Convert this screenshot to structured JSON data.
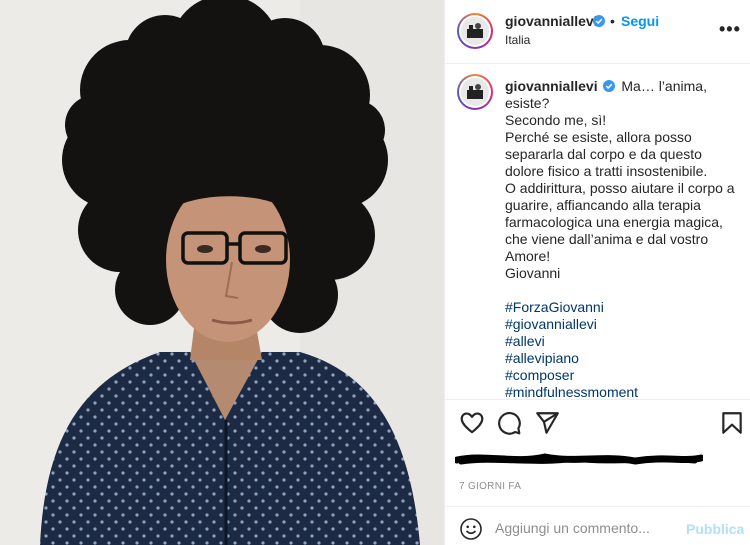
{
  "post": {
    "username": "giovanniallevi",
    "dot": "•",
    "follow_label": "Segui",
    "location": "Italia",
    "more_icon": "more-horizontal-icon",
    "verified_color": "#3897f0"
  },
  "caption": {
    "username": "giovanniallevi",
    "lines": [
      "Ma… l’anima, esiste?",
      "Secondo me, sì!",
      "Perché se esiste, allora posso separarla dal corpo e da questo dolore fisico a tratti insostenibile.",
      "O addirittura, posso aiutare il corpo a guarire, affiancando alla terapia farmacologica una energia magica, che viene dall’anima e dal vostro Amore!",
      "Giovanni"
    ],
    "hashtags": [
      "#ForzaGiovanni",
      "#giovanniallevi",
      "#allevi",
      "#allevipiano",
      "#composer",
      "#mindfulnessmoment"
    ]
  },
  "actions": {
    "like_icon": "heart-icon",
    "comment_icon": "comment-icon",
    "share_icon": "send-icon",
    "save_icon": "bookmark-icon"
  },
  "timestamp": "7 GIORNI FA",
  "comment": {
    "emoji_icon": "emoji-icon",
    "placeholder": "Aggiungi un commento...",
    "publish_label": "Pubblica"
  },
  "colors": {
    "link_blue": "#0095f6",
    "hashtag_blue": "#00376b",
    "publish_disabled": "#b2dffc",
    "muted": "#8e8e8e"
  }
}
